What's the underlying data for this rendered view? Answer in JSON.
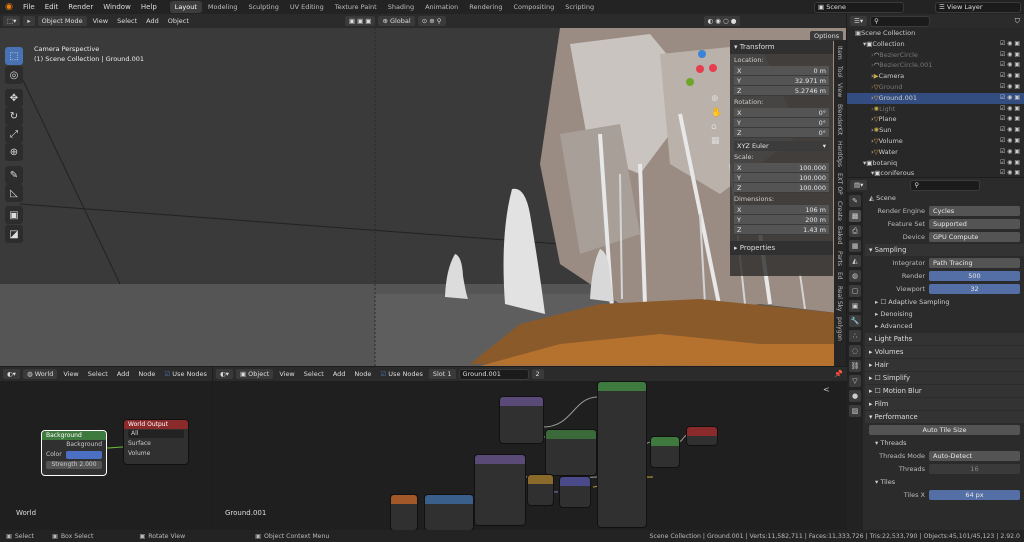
{
  "menu": [
    "File",
    "Edit",
    "Render",
    "Window",
    "Help"
  ],
  "workspaces": [
    "Layout",
    "Modeling",
    "Sculpting",
    "UV Editing",
    "Texture Paint",
    "Shading",
    "Animation",
    "Rendering",
    "Compositing",
    "Scripting"
  ],
  "active_workspace": "Layout",
  "scene_name": "Scene",
  "view_layer": "View Layer",
  "viewport": {
    "mode": "Object Mode",
    "menus": [
      "View",
      "Select",
      "Add",
      "Object"
    ],
    "orientation": "Global",
    "options_label": "Options",
    "overlay_line1": "Camera Perspective",
    "overlay_line2": "(1) Scene Collection | Ground.001"
  },
  "npanel": {
    "transform_title": "Transform",
    "location_label": "Location:",
    "location": [
      {
        "axis": "X",
        "value": "0 m"
      },
      {
        "axis": "Y",
        "value": "32.971 m"
      },
      {
        "axis": "Z",
        "value": "5.2746 m"
      }
    ],
    "rotation_label": "Rotation:",
    "rotation": [
      {
        "axis": "X",
        "value": "0°"
      },
      {
        "axis": "Y",
        "value": "0°"
      },
      {
        "axis": "Z",
        "value": "0°"
      }
    ],
    "rotation_mode": "XYZ Euler",
    "scale_label": "Scale:",
    "scale": [
      {
        "axis": "X",
        "value": "100.000"
      },
      {
        "axis": "Y",
        "value": "100.000"
      },
      {
        "axis": "Z",
        "value": "100.000"
      }
    ],
    "dimensions_label": "Dimensions:",
    "dimensions": [
      {
        "axis": "X",
        "value": "106 m"
      },
      {
        "axis": "Y",
        "value": "200 m"
      },
      {
        "axis": "Z",
        "value": "1.43 m"
      }
    ],
    "properties_title": "Properties",
    "side_tabs": [
      "Item",
      "Tool",
      "View",
      "BlenderKit",
      "HardOps",
      "EXT OP",
      "Create",
      "Baked",
      "Parts",
      "Ed",
      "Real Sky",
      "polygon"
    ]
  },
  "outliner": {
    "root": "Scene Collection",
    "rows": [
      {
        "name": "Collection",
        "indent": 1,
        "state": "normal",
        "icon": "collection-icon"
      },
      {
        "name": "BezierCircle",
        "indent": 2,
        "state": "dim",
        "icon": "curve-icon"
      },
      {
        "name": "BezierCircle.001",
        "indent": 2,
        "state": "dim",
        "icon": "curve-icon"
      },
      {
        "name": "Camera",
        "indent": 2,
        "state": "normal",
        "icon": "camera-icon"
      },
      {
        "name": "Ground",
        "indent": 2,
        "state": "dim",
        "icon": "mesh-icon"
      },
      {
        "name": "Ground.001",
        "indent": 2,
        "state": "sel",
        "icon": "mesh-icon"
      },
      {
        "name": "Light",
        "indent": 2,
        "state": "dim",
        "icon": "light-icon"
      },
      {
        "name": "Plane",
        "indent": 2,
        "state": "normal",
        "icon": "mesh-icon"
      },
      {
        "name": "Sun",
        "indent": 2,
        "state": "normal",
        "icon": "light-icon"
      },
      {
        "name": "Volume",
        "indent": 2,
        "state": "normal",
        "icon": "mesh-icon"
      },
      {
        "name": "Water",
        "indent": 2,
        "state": "normal",
        "icon": "mesh-icon"
      },
      {
        "name": "botaniq",
        "indent": 1,
        "state": "normal",
        "icon": "collection-icon"
      },
      {
        "name": "coniferous",
        "indent": 2,
        "state": "normal",
        "icon": "collection-icon"
      }
    ]
  },
  "properties": {
    "search_placeholder": "",
    "scene_label": "Scene",
    "render_engine_label": "Render Engine",
    "render_engine": "Cycles",
    "feature_set_label": "Feature Set",
    "feature_set": "Supported",
    "device_label": "Device",
    "device": "GPU Compute",
    "sampling": "Sampling",
    "integrator_label": "Integrator",
    "integrator": "Path Tracing",
    "render_label": "Render",
    "render_samples": "500",
    "viewport_label": "Viewport",
    "viewport_samples": "32",
    "adaptive": "Adaptive Sampling",
    "denoising": "Denoising",
    "advanced": "Advanced",
    "light_paths": "Light Paths",
    "volumes": "Volumes",
    "hair": "Hair",
    "simplify": "Simplify",
    "motion_blur": "Motion Blur",
    "film": "Film",
    "performance": "Performance",
    "auto_tile": "Auto Tile Size",
    "threads": "Threads",
    "threads_mode_label": "Threads Mode",
    "threads_mode": "Auto-Detect",
    "threads_label": "Threads",
    "threads_value": "16",
    "tiles": "Tiles",
    "tiles_x_label": "Tiles X",
    "tiles_x": "64 px"
  },
  "world_editor": {
    "type": "World",
    "menus": [
      "View",
      "Select",
      "Add",
      "Node"
    ],
    "use_nodes": "Use Nodes",
    "label": "World",
    "bg_node": {
      "title": "Background",
      "output": "Background",
      "color": "Color",
      "strength_label": "Strength",
      "strength": "2.000"
    },
    "out_node": {
      "title": "World Output",
      "target": "All",
      "surface": "Surface",
      "volume": "Volume"
    }
  },
  "object_editor": {
    "type": "Object",
    "menus": [
      "View",
      "Select",
      "Add",
      "Node"
    ],
    "use_nodes": "Use Nodes",
    "slot": "Slot 1",
    "material": "Ground.001",
    "users": "2",
    "label": "Ground.001"
  },
  "status": {
    "select": "Select",
    "box_select": "Box Select",
    "rotate_view": "Rotate View",
    "context_menu": "Object Context Menu",
    "stats": "Scene Collection | Ground.001 | Verts:11,582,711 | Faces:11,333,726 | Tris:22,533,790 | Objects:45,101/45,123 | 2.92.0"
  }
}
